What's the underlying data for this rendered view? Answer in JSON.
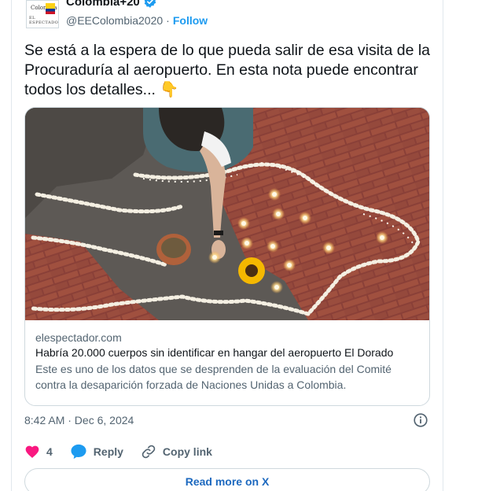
{
  "author": {
    "display_name": "Colombia+20",
    "handle": "@EEColombia2020",
    "follow_label": "Follow",
    "avatar_top_text": "Colombia",
    "avatar_bottom_text": "EL ESPECTADOR",
    "verified_icon": "verified-badge-icon"
  },
  "tweet": {
    "text": "Se está a la espera de lo que pueda salir de esa visita de la Procuraduría al aeropuerto. En esta nota puede encontrar todos los detalles... 👇",
    "timestamp": "8:42 AM · Dec 6, 2024"
  },
  "link_card": {
    "domain": "elespectador.com",
    "title": "Habría 20.000 cuerpos sin identificar en hangar del aeropuerto El Dorado",
    "description": "Este es uno de los datos que se desprenden de la evaluación del Comité contra la desaparición forzada de Naciones Unidas a Colombia."
  },
  "actions": {
    "like_count": "4",
    "reply_label": "Reply",
    "copy_link_label": "Copy link"
  },
  "read_more_label": "Read more on X",
  "colors": {
    "accent": "#1d9bf0",
    "like": "#f91880",
    "text": "#0f1419",
    "muted": "#536471"
  }
}
